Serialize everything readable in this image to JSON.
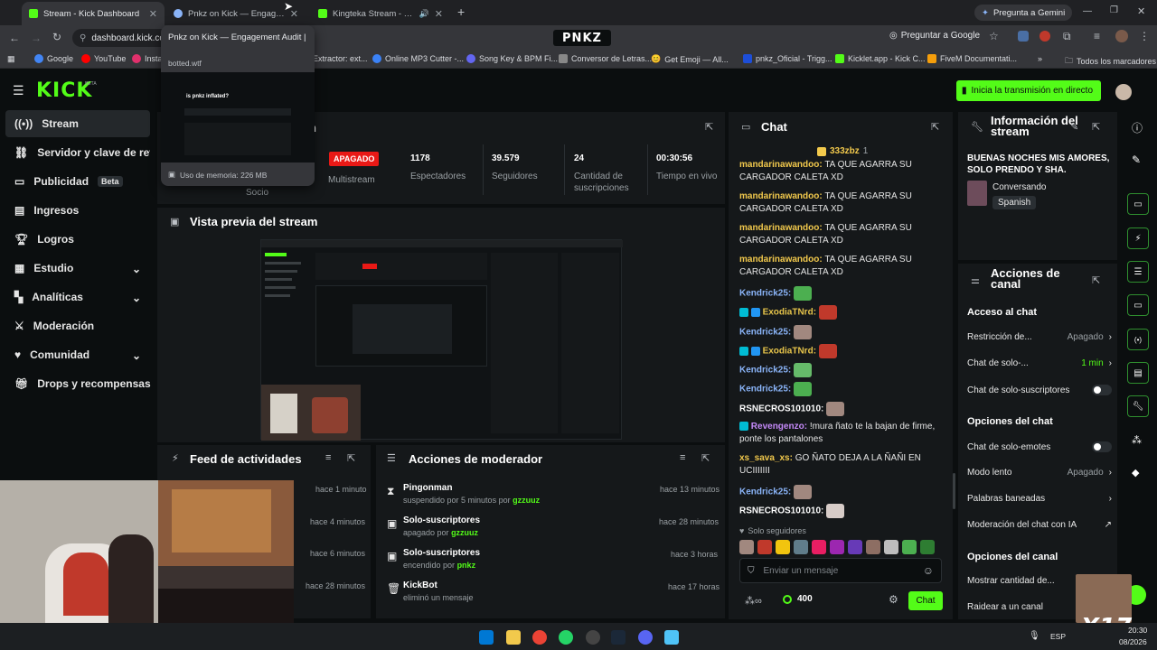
{
  "browser": {
    "tabs": [
      {
        "title": "Stream - Kick Dashboard"
      },
      {
        "title": "Pnkz on Kick — Engagement Audit"
      },
      {
        "title": "Kingteka Stream - Watch Live"
      }
    ],
    "url": "dashboard.kick.com",
    "center_logo": "PNKZ",
    "google_btn": "Preguntar a Google",
    "gemini_btn": "Pregunta a Gemini",
    "bookmarks": [
      "Google",
      "YouTube",
      "Insta",
      "Extractor: ext...",
      "Online MP3 Cutter -...",
      "Song Key & BPM Fi...",
      "Conversor de Letras...",
      "Get Emoji — All...",
      "pnkz_Oficial - Trigg...",
      "Kicklet.app - Kick C...",
      "FiveM Documentati..."
    ],
    "all_bookmarks": "Todos los marcadores",
    "tooltip": {
      "title": "Pnkz on Kick — Engagement Audit |",
      "domain": "botted.wtf",
      "question": "is pnkz inflated?",
      "memory": "Uso de memoria: 226 MB"
    }
  },
  "header": {
    "logo": "KICK",
    "logo_beta": "BETA",
    "start_stream": "Inicia la transmisión en directo"
  },
  "sidebar": {
    "items": [
      {
        "label": "Stream"
      },
      {
        "label": "Servidor y clave de retransmisión"
      },
      {
        "label": "Publicidad",
        "badge": "Beta"
      },
      {
        "label": "Ingresos"
      },
      {
        "label": "Logros"
      },
      {
        "label": "Estudio"
      },
      {
        "label": "Analíticas"
      },
      {
        "label": "Moderación"
      },
      {
        "label": "Comunidad"
      },
      {
        "label": "Drops y recompensas"
      }
    ]
  },
  "session": {
    "title_partial": "n",
    "role": "Socio",
    "multistream_badge": "APAGADO",
    "multistream_label": "Multistream",
    "stats": [
      {
        "value": "1178",
        "label": "Espectadores"
      },
      {
        "value": "39.579",
        "label": "Seguidores"
      },
      {
        "value": "24",
        "label": "Cantidad de suscripciones"
      },
      {
        "value": "00:30:56",
        "label": "Tiempo en vivo"
      }
    ]
  },
  "preview": {
    "title": "Vista previa del stream"
  },
  "feed": {
    "title": "Feed de actividades",
    "times": [
      "hace 1 minuto",
      "hace 4 minutos",
      "hace 6 minutos",
      "hace 28 minutos"
    ]
  },
  "modactions": {
    "title": "Acciones de moderador",
    "items": [
      {
        "name": "Pingonman",
        "detail": "suspendido por 5 minutos por",
        "by": "gzzuuz",
        "time": "hace 13 minutos"
      },
      {
        "name": "Solo-suscriptores",
        "detail": "apagado por",
        "by": "gzzuuz",
        "time": "hace 28 minutos"
      },
      {
        "name": "Solo-suscriptores",
        "detail": "encendido por",
        "by": "pnkz",
        "time": "hace 3 horas"
      },
      {
        "name": "KickBot",
        "detail": "eliminó un mensaje",
        "by": "",
        "time": "hace 17 horas"
      }
    ]
  },
  "chat": {
    "title": "Chat",
    "pinned_user": "333zbz",
    "pinned_count": "1",
    "messages": [
      {
        "user": "mandarinawandoo",
        "text": "TA QUE AGARRA SU CARGADOR CALETA XD",
        "color": "#f2c94c"
      },
      {
        "user": "mandarinawandoo",
        "text": "TA QUE AGARRA SU CARGADOR CALETA XD",
        "color": "#f2c94c"
      },
      {
        "user": "mandarinawandoo",
        "text": "TA QUE AGARRA SU CARGADOR CALETA XD",
        "color": "#f2c94c"
      },
      {
        "user": "mandarinawandoo",
        "text": "TA QUE AGARRA SU CARGADOR CALETA XD",
        "color": "#f2c94c"
      },
      {
        "user": "Kendrick25",
        "text": "",
        "color": "#8ab4f8"
      },
      {
        "user": "ExodiaTNrd",
        "text": "",
        "color": "#e5c34a"
      },
      {
        "user": "Kendrick25",
        "text": "",
        "color": "#8ab4f8"
      },
      {
        "user": "ExodiaTNrd",
        "text": "",
        "color": "#e5c34a"
      },
      {
        "user": "Kendrick25",
        "text": "",
        "color": "#8ab4f8"
      },
      {
        "user": "Kendrick25",
        "text": "",
        "color": "#8ab4f8"
      },
      {
        "user": "RSNECROS101010",
        "text": "",
        "color": "#ffffff"
      },
      {
        "user": "Revengenzo",
        "text": "!mura ñato te la bajan de firme, ponte los pantalones",
        "color": "#c58af9"
      },
      {
        "user": "xs_sava_xs",
        "text": "GO ÑATO DEJA A LA ÑAÑI EN UCIIIIIII",
        "color": "#f2c94c"
      },
      {
        "user": "Kendrick25",
        "text": "",
        "color": "#8ab4f8"
      },
      {
        "user": "RSNECROS101010",
        "text": "",
        "color": "#ffffff"
      }
    ],
    "followers_only": "Solo seguidores",
    "input_placeholder": "Enviar un mensaje",
    "points": "400",
    "send_btn": "Chat"
  },
  "stream_info": {
    "title": "Información del stream",
    "stream_title": "BUENAS NOCHES MIS AMORES, SOLO PRENDO Y SHA.",
    "category": "Conversando",
    "language": "Spanish"
  },
  "channel_actions": {
    "title": "Acciones de canal",
    "chat_access": "Acceso al chat",
    "restriction_label": "Restricción de...",
    "restriction_value": "Apagado",
    "slow_only_label": "Chat de solo-...",
    "slow_only_value": "1 min",
    "subs_only_label": "Chat de solo-suscriptores",
    "chat_options": "Opciones del chat",
    "emotes_only": "Chat de solo-emotes",
    "slow_mode_label": "Modo lento",
    "slow_mode_value": "Apagado",
    "banned_words": "Palabras baneadas",
    "ai_mod": "Moderación del chat con IA",
    "channel_options": "Opciones del canal",
    "show_count": "Mostrar cantidad de...",
    "raid": "Raidear a un canal"
  },
  "taskbar": {
    "lang": "ESP",
    "time": "20:30",
    "date": "08/2026",
    "watermark": "X17"
  }
}
